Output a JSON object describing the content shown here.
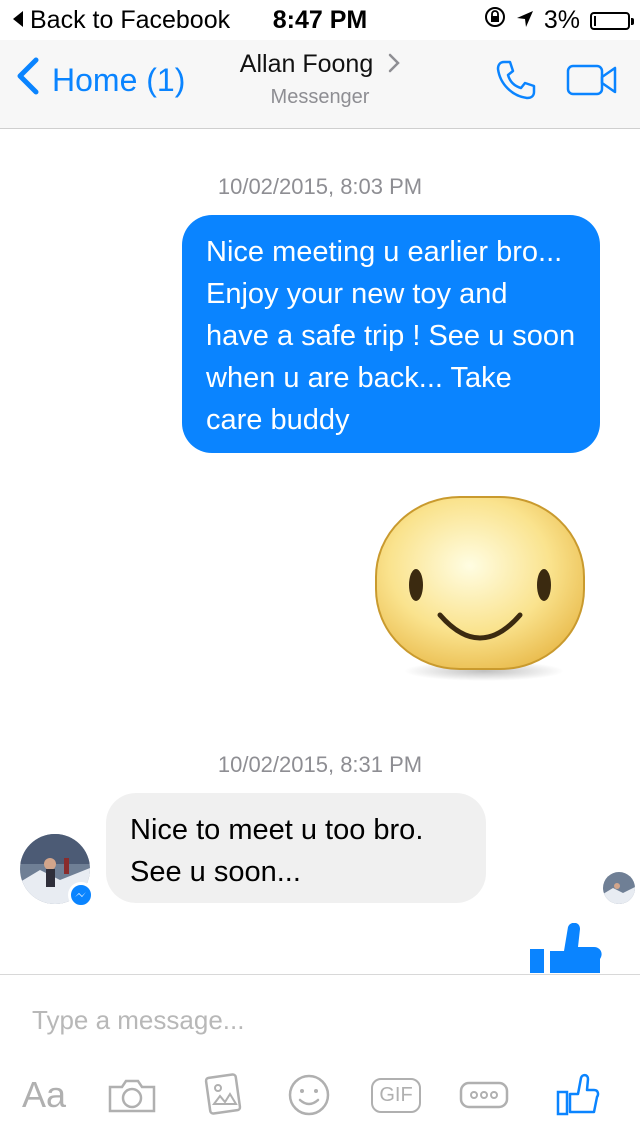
{
  "status_bar": {
    "back_label": "Back to Facebook",
    "time": "8:47 PM",
    "battery": "3%"
  },
  "nav": {
    "back_label": "Home (1)",
    "title": "Allan Foong",
    "subtitle": "Messenger"
  },
  "messages": [
    {
      "type": "timestamp",
      "text": "10/02/2015, 8:03 PM"
    },
    {
      "type": "outgoing",
      "text": "Nice meeting u earlier bro... Enjoy your new toy and have a safe trip ! See u soon when u are back... Take care buddy"
    },
    {
      "type": "sticker",
      "icon": "smiley-sticker"
    },
    {
      "type": "timestamp",
      "text": "10/02/2015, 8:31 PM"
    },
    {
      "type": "incoming",
      "text": "Nice to meet u too bro. See u soon..."
    }
  ],
  "composer": {
    "placeholder": "Type a message...",
    "tools": [
      "Aa",
      "camera-icon",
      "photo-icon",
      "emoji-icon",
      "GIF",
      "more-icon",
      "like-icon"
    ]
  },
  "colors": {
    "accent": "#0a84ff",
    "incoming_bubble": "#f0f0f0",
    "tool_gray": "#b0b0b0"
  }
}
